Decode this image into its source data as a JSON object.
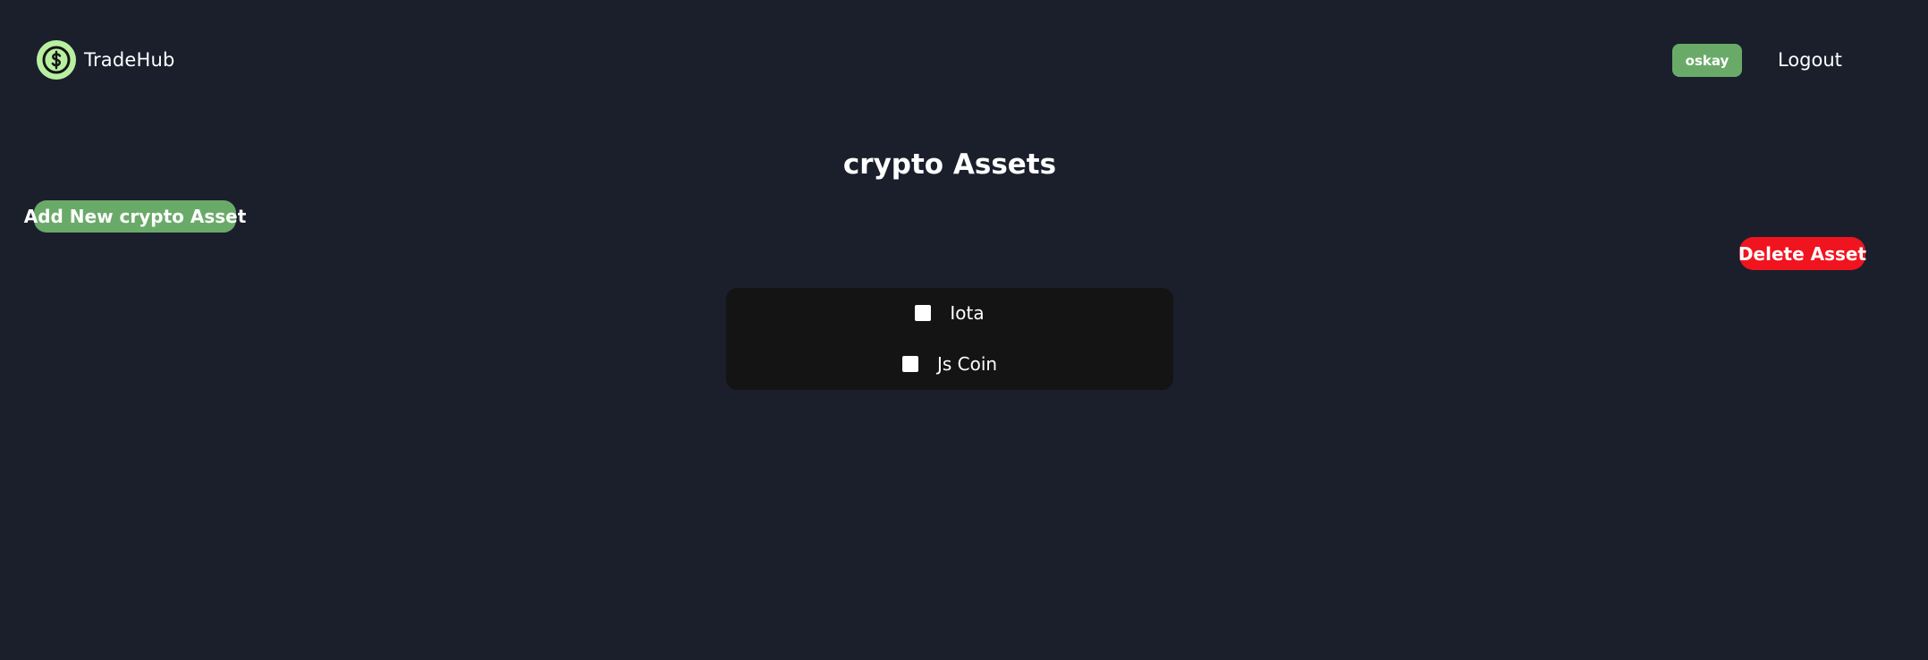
{
  "header": {
    "brand_name": "TradeHub",
    "logo_icon": "dollar-circle-icon",
    "username": "oskay",
    "logout_label": "Logout"
  },
  "main": {
    "title": "crypto Assets",
    "add_button_label": "Add New crypto Asset",
    "delete_button_label": "Delete Asset",
    "assets": [
      {
        "label": "Iota",
        "checked": false
      },
      {
        "label": "Js Coin",
        "checked": false
      }
    ]
  },
  "colors": {
    "background": "#1b1f2c",
    "accent_green": "#6aaa69",
    "logo_green": "#b8f0a0",
    "danger_red": "#f0141f",
    "panel": "#141414"
  }
}
